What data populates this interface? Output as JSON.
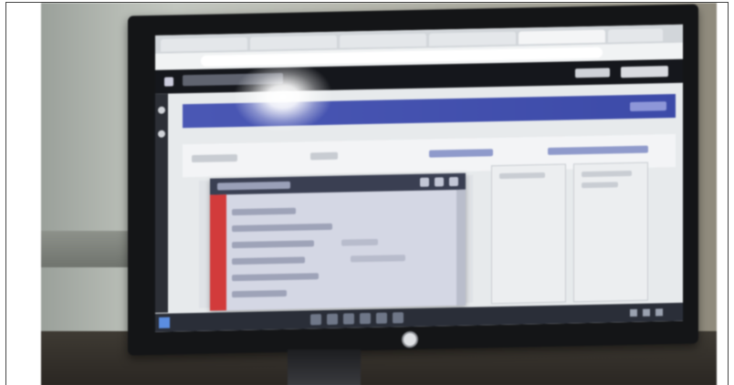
{
  "photo": {
    "subject": "",
    "browser": {
      "tab_count": 6,
      "url": ""
    },
    "app": {
      "header_title": "",
      "user_label": "",
      "logout_label": "",
      "page_title": "",
      "page_action": "",
      "dialog_title": ""
    },
    "colors": {
      "app_header": "#15171c",
      "title_strip": "#4a57b4",
      "dialog_accent": "#d23b3b",
      "taskbar": "#2a2e38"
    }
  }
}
